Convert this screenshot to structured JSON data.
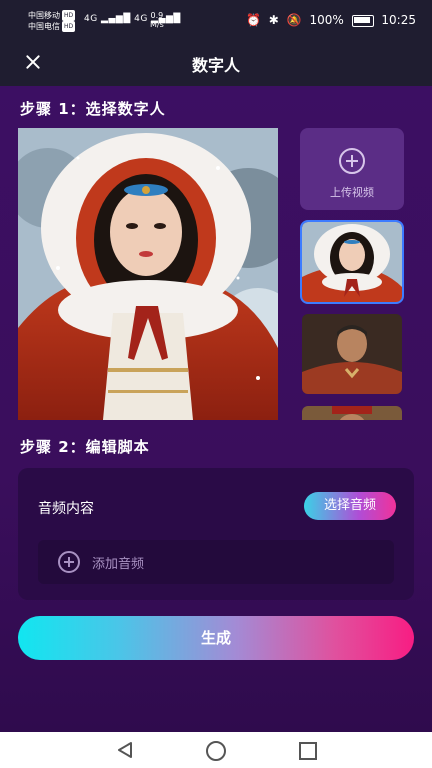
{
  "status_bar": {
    "carrier1": "中国移动",
    "carrier2": "中国电信",
    "hd": "HD",
    "signal": "4G ▂▄▆█ 4G ▂▄▆█",
    "speed_value": "0.9",
    "speed_unit": "M/s",
    "battery": "100%",
    "time": "10:25"
  },
  "header": {
    "title": "数字人"
  },
  "step1": {
    "label": "步骤 1：选择数字人",
    "upload_label": "上传视频"
  },
  "step2": {
    "label": "步骤 2：编辑脚本",
    "audio_title": "音频内容",
    "select_audio": "选择音频",
    "add_audio": "添加音频"
  },
  "generate_label": "生成",
  "colors": {
    "background": "#3b1060",
    "header": "#1f1d30",
    "card": "#2a0b47",
    "accent_cyan": "#11e6f0",
    "accent_pink": "#f81d83",
    "selected_outline": "#3d7bff"
  },
  "icons": {
    "close": "close-icon",
    "upload": "plus-circle-icon",
    "add_audio": "plus-circle-icon",
    "nav_back": "triangle-back-icon",
    "nav_home": "circle-home-icon",
    "nav_recent": "square-recent-icon"
  }
}
